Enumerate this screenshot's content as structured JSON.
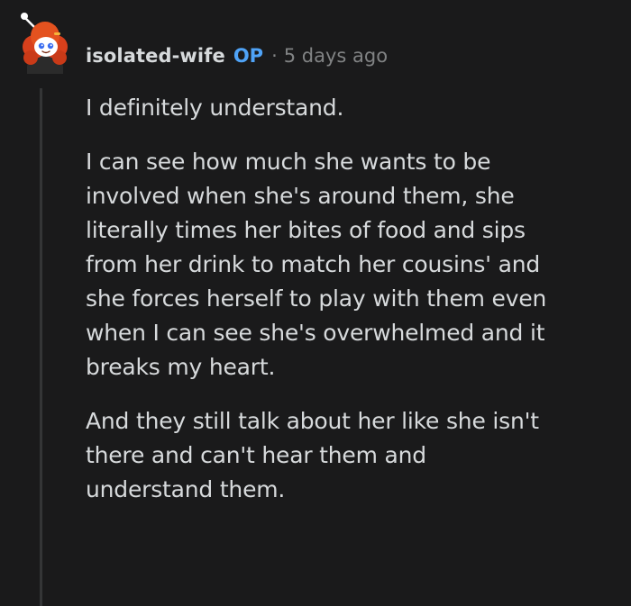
{
  "comment": {
    "author": "isolated-wife",
    "badge": "OP",
    "separator": "·",
    "timestamp": "5 days ago",
    "avatar_icon": "snoo-avatar-icon",
    "paragraphs": [
      "I definitely understand.",
      "I can see how much she wants to be\ninvolved when she's around them, she\nliterally times her bites of food and sips\nfrom her drink to match her cousins' and\nshe forces herself to play with them even\nwhen I can see she's overwhelmed and it\nbreaks my heart.",
      "And they still talk about her like she isn't\nthere and can't hear them and\nunderstand them."
    ]
  },
  "colors": {
    "background": "#1a1a1b",
    "text": "#d7dadc",
    "op_badge": "#4fa3f7",
    "meta": "#818384",
    "thread_line": "#343536"
  }
}
